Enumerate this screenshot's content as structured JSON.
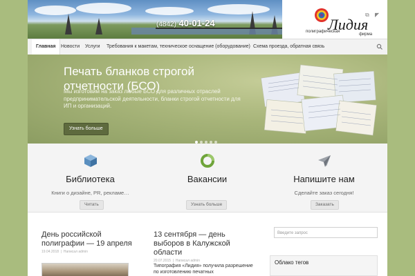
{
  "header": {
    "phone_code": "(4842)",
    "phone_number": "40-01-24",
    "logo_title": "Лидия",
    "logo_sub": "полиграфическая",
    "logo_sub2": "фирма",
    "social_icons": [
      "feed-icon",
      "rss-icon"
    ]
  },
  "nav": {
    "items": [
      "Главная",
      "Новости",
      "Услуги",
      "Требования к макетам, техническое оснащение (оборудование)",
      "Схема проезда, обратная связь"
    ],
    "active_index": 0
  },
  "slider": {
    "title": "Печать бланков строгой отчетности (БСО)",
    "text": "Мы изготовим на заказ любые БСО для различных отраслей предпринимательской деятельности, бланки строгой отчетности для ИП и организаций.",
    "button": "Узнать больше",
    "dots_count": 5,
    "active_dot": 0
  },
  "features": [
    {
      "icon": "cube-icon",
      "title": "Библиотека",
      "text": "Книги о дизайне, PR, рекламе…",
      "button": "Читать"
    },
    {
      "icon": "ring-icon",
      "title": "Вакансии",
      "text": "",
      "button": "Узнать больше"
    },
    {
      "icon": "paper-plane-icon",
      "title": "Напишите нам",
      "text": "Сделайте заказ сегодня!",
      "button": "Заказать"
    }
  ],
  "posts": [
    {
      "title": "День российской полиграфии — 19 апреля",
      "date": "19.04.2018",
      "author": "Написал admin"
    },
    {
      "title": "13 сентября — день выборов в Калужской области",
      "date": "20.07.2015",
      "author": "Написал admin",
      "excerpt": "Типография «Лидия» получила разрешение по изготовлению печатных"
    }
  ],
  "sidebar": {
    "search_placeholder": "Введите запрос",
    "tag_cloud_title": "Облако тегов"
  },
  "colors": {
    "outer_bg": "#a9bc7e",
    "slider_button": "#5e6a3e",
    "feature_icon_green": "#6fa43a",
    "feature_icon_blue": "#5a8fbf",
    "feature_icon_gray": "#8a8f96"
  }
}
